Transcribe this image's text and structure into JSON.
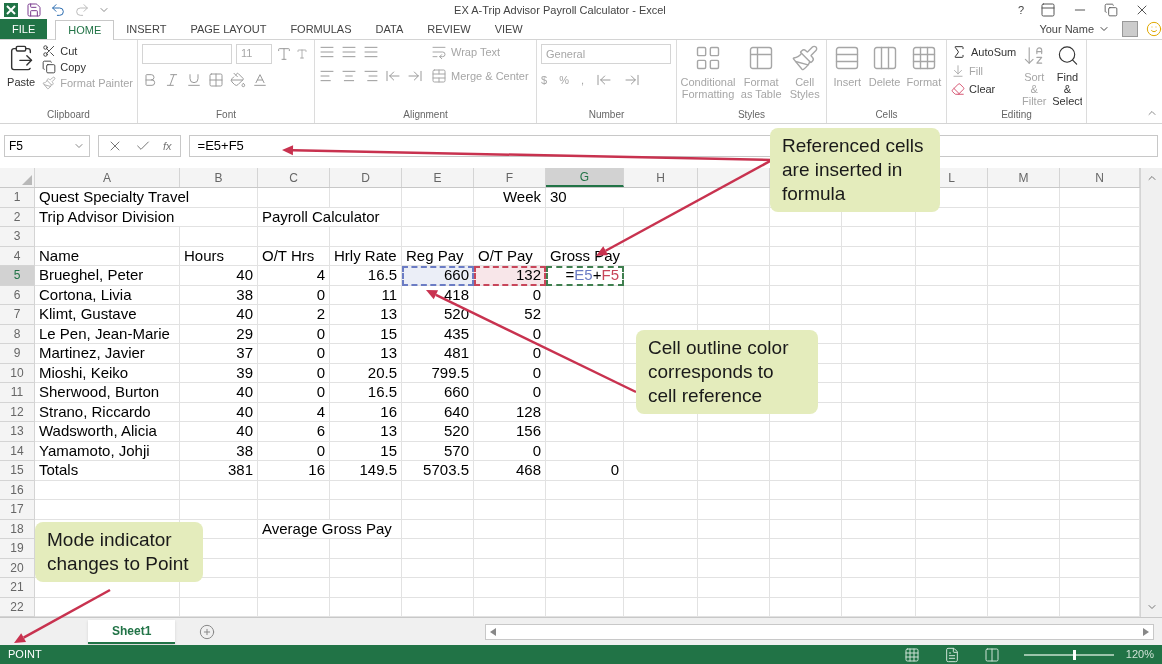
{
  "window": {
    "title": "EX A-Trip Advisor Payroll Calculator - Excel",
    "help": "?",
    "user": "Your Name"
  },
  "tabs": [
    {
      "label": "FILE",
      "kind": "file",
      "selected": false
    },
    {
      "label": "HOME",
      "kind": "tab",
      "selected": true
    },
    {
      "label": "INSERT",
      "kind": "tab",
      "selected": false
    },
    {
      "label": "PAGE LAYOUT",
      "kind": "tab",
      "selected": false
    },
    {
      "label": "FORMULAS",
      "kind": "tab",
      "selected": false
    },
    {
      "label": "DATA",
      "kind": "tab",
      "selected": false
    },
    {
      "label": "REVIEW",
      "kind": "tab",
      "selected": false
    },
    {
      "label": "VIEW",
      "kind": "tab",
      "selected": false
    }
  ],
  "ribbon": {
    "groups": [
      {
        "label": "Clipboard",
        "items": [
          {
            "label": "Paste",
            "disabled": false
          },
          {
            "label": "Cut",
            "disabled": false
          },
          {
            "label": "Copy",
            "disabled": false
          },
          {
            "label": "Format Painter",
            "disabled": true
          }
        ]
      },
      {
        "label": "Font",
        "items": [
          {
            "label": "11",
            "disabled": true
          }
        ]
      },
      {
        "label": "Alignment",
        "items": [
          {
            "label": "Wrap Text",
            "disabled": true
          },
          {
            "label": "Merge & Center",
            "disabled": true
          }
        ]
      },
      {
        "label": "Number",
        "items": [
          {
            "label": "General",
            "disabled": true
          },
          {
            "label": "$",
            "disabled": true
          },
          {
            "label": "%",
            "disabled": true
          },
          {
            "label": ",",
            "disabled": true
          }
        ]
      },
      {
        "label": "Styles",
        "items": [
          {
            "label": "Conditional Formatting",
            "disabled": true
          },
          {
            "label": "Format as Table",
            "disabled": true
          },
          {
            "label": "Cell Styles",
            "disabled": true
          }
        ]
      },
      {
        "label": "Cells",
        "items": [
          {
            "label": "Insert",
            "disabled": true
          },
          {
            "label": "Delete",
            "disabled": true
          },
          {
            "label": "Format",
            "disabled": true
          }
        ]
      },
      {
        "label": "Editing",
        "items": [
          {
            "label": "AutoSum",
            "disabled": false
          },
          {
            "label": "Fill",
            "disabled": true
          },
          {
            "label": "Clear",
            "disabled": false
          },
          {
            "label": "Sort & Filter",
            "disabled": true
          },
          {
            "label": "Find & Select",
            "disabled": false
          }
        ]
      }
    ]
  },
  "formula_bar": {
    "name_box": "F5",
    "function_label": "fx",
    "formula": "=E5+F5"
  },
  "sheet": {
    "columns": [
      {
        "label": "A",
        "selected": false
      },
      {
        "label": "B",
        "selected": false
      },
      {
        "label": "C",
        "selected": false
      },
      {
        "label": "D",
        "selected": false
      },
      {
        "label": "E",
        "selected": false
      },
      {
        "label": "F",
        "selected": false
      },
      {
        "label": "G",
        "selected": true
      },
      {
        "label": "H",
        "selected": false
      },
      null,
      null,
      null,
      {
        "label": "L",
        "selected": false
      },
      {
        "label": "M",
        "selected": false
      },
      {
        "label": "N",
        "selected": false
      }
    ],
    "rows": [
      {
        "number": "1",
        "kind": "label",
        "selected": false,
        "cells": [
          "Quest Specialty Travel",
          null,
          null,
          null,
          null,
          {
            "text": "Week",
            "right_aligned": true
          },
          "30"
        ]
      },
      {
        "number": "2",
        "kind": "label",
        "selected": false,
        "cells": [
          "Trip Advisor Division",
          null,
          "Payroll Calculator"
        ]
      },
      {
        "number": "3",
        "selected": false,
        "cells": []
      },
      {
        "number": "4",
        "kind": "label",
        "selected": false,
        "cells": [
          "Name",
          "Hours",
          "O/T Hrs",
          "Hrly Rate",
          "Reg Pay",
          "O/T Pay",
          "Gross Pay"
        ]
      },
      {
        "number": "5",
        "kind": "data",
        "selected": true,
        "cells": [
          "Brueghel, Peter",
          "40",
          "4",
          "16.5",
          {
            "text": "660",
            "color": "#6b7cc4"
          },
          {
            "text": "132",
            "color": "#c8465a"
          },
          {
            "parts": [
              {
                "text": "="
              },
              {
                "text": "E5",
                "color": "#6b7cc4"
              },
              {
                "text": "+"
              },
              {
                "text": "F5",
                "color": "#c8465a"
              }
            ],
            "color": "#3f7f4f"
          }
        ]
      },
      {
        "number": "6",
        "kind": "data",
        "selected": false,
        "cells": [
          "Cortona, Livia",
          "38",
          "0",
          "11",
          "418",
          "0"
        ]
      },
      {
        "number": "7",
        "kind": "data",
        "selected": false,
        "cells": [
          "Klimt, Gustave",
          "40",
          "2",
          "13",
          "520",
          "52"
        ]
      },
      {
        "number": "8",
        "kind": "data",
        "selected": false,
        "cells": [
          "Le Pen, Jean-Marie",
          "29",
          "0",
          "15",
          "435",
          "0"
        ]
      },
      {
        "number": "9",
        "kind": "data",
        "selected": false,
        "cells": [
          "Martinez, Javier",
          "37",
          "0",
          "13",
          "481",
          "0"
        ]
      },
      {
        "number": "10",
        "kind": "data",
        "selected": false,
        "cells": [
          "Mioshi, Keiko",
          "39",
          "0",
          "20.5",
          "799.5",
          "0"
        ]
      },
      {
        "number": "11",
        "kind": "data",
        "selected": false,
        "cells": [
          "Sherwood, Burton",
          "40",
          "0",
          "16.5",
          "660",
          "0"
        ]
      },
      {
        "number": "12",
        "kind": "data",
        "selected": false,
        "cells": [
          "Strano, Riccardo",
          "40",
          "4",
          "16",
          "640",
          "128"
        ]
      },
      {
        "number": "13",
        "kind": "data",
        "selected": false,
        "cells": [
          "Wadsworth, Alicia",
          "40",
          "6",
          "13",
          "520",
          "156"
        ]
      },
      {
        "number": "14",
        "kind": "data",
        "selected": false,
        "cells": [
          "Yamamoto, Johji",
          "38",
          "0",
          "15",
          "570",
          "0"
        ]
      },
      {
        "number": "15",
        "kind": "data",
        "selected": false,
        "cells": [
          "Totals",
          "381",
          "16",
          "149.5",
          "5703.5",
          "468",
          "0"
        ]
      },
      {
        "number": "16",
        "selected": false,
        "cells": []
      },
      {
        "number": "17",
        "selected": false,
        "cells": []
      },
      {
        "number": "18",
        "kind": "label",
        "selected": false,
        "cells": [
          null,
          null,
          "Average Gross Pay"
        ]
      },
      {
        "number": "19",
        "selected": false,
        "cells": []
      },
      {
        "number": "20",
        "selected": false,
        "cells": []
      },
      {
        "number": "21",
        "selected": false,
        "cells": []
      },
      {
        "number": "22",
        "selected": false,
        "cells": []
      }
    ]
  },
  "sheet_tabs": [
    {
      "label": "Sheet1",
      "selected": true
    }
  ],
  "status_bar": {
    "mode": "POINT",
    "zoom": {
      "reading": "120%",
      "level": 0.55
    }
  },
  "callouts": [
    {
      "text": "Referenced cells are inserted in formula"
    },
    {
      "text": "Cell outline color corresponds to cell reference"
    },
    {
      "text": "Mode indicator changes to Point"
    }
  ]
}
